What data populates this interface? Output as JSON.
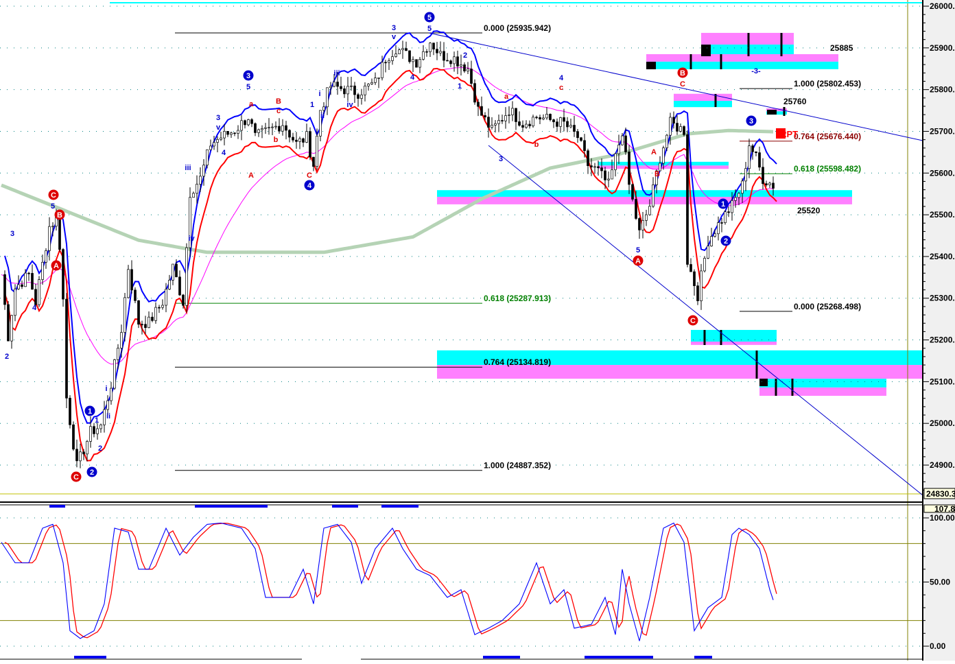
{
  "chart_data": {
    "type": "candlestick",
    "title": "",
    "colors": {
      "up": "#ffffff",
      "down": "#000000",
      "upper_band": "#0000ff",
      "lower_band": "#ff0000",
      "slow_ma": "#ff00ff",
      "long_ma": "#b5d3b5",
      "cyan": "#00ffff",
      "magenta": "#ff80ff",
      "stoch_k": "#0000ff",
      "stoch_d": "#ff0000",
      "trend": "#0000cc"
    },
    "price_axis": {
      "ylim": [
        24830,
        26000
      ],
      "ticks": [
        "26000.",
        "25900.",
        "25800.",
        "25700.",
        "25600.",
        "25500.",
        "25400.",
        "25300.",
        "25200.",
        "25100.",
        "25000.",
        "24900."
      ],
      "tick_values": [
        26000,
        25900,
        25800,
        25700,
        25600,
        25500,
        25400,
        25300,
        25200,
        25100,
        25000,
        24900
      ],
      "current_label": "24830.3"
    },
    "osc_axis": {
      "ylim": [
        0,
        100
      ],
      "ticks": [
        "100.00",
        "50.00",
        "0.00"
      ],
      "tick_values": [
        100,
        50,
        0
      ],
      "top_label": "107.8",
      "levels": [
        80,
        20
      ]
    },
    "price_path": [
      [
        0,
        25357
      ],
      [
        2,
        25209
      ],
      [
        4,
        25324
      ],
      [
        8,
        25357
      ],
      [
        10,
        25291
      ],
      [
        14,
        25472
      ],
      [
        16,
        25489
      ],
      [
        17.6,
        25390
      ],
      [
        19,
        25061
      ],
      [
        22,
        24897
      ],
      [
        26,
        24979
      ],
      [
        29,
        24995
      ],
      [
        32,
        25094
      ],
      [
        35,
        25226
      ],
      [
        37,
        25374
      ],
      [
        40,
        25242
      ],
      [
        43,
        25242
      ],
      [
        47,
        25291
      ],
      [
        50,
        25374
      ],
      [
        53,
        25291
      ],
      [
        55,
        25554
      ],
      [
        58,
        25587
      ],
      [
        61,
        25670
      ],
      [
        64,
        25686
      ],
      [
        68,
        25702
      ],
      [
        72,
        25735
      ],
      [
        74,
        25686
      ],
      [
        78,
        25702
      ],
      [
        82,
        25719
      ],
      [
        86,
        25670
      ],
      [
        89,
        25686
      ],
      [
        91,
        25620
      ],
      [
        93,
        25752
      ],
      [
        96,
        25809
      ],
      [
        100,
        25801
      ],
      [
        104,
        25793
      ],
      [
        109,
        25817
      ],
      [
        112,
        25875
      ],
      [
        115,
        25900
      ],
      [
        118,
        25883
      ],
      [
        121,
        25867
      ],
      [
        125,
        25916
      ],
      [
        128,
        25883
      ],
      [
        132,
        25875
      ],
      [
        136,
        25850
      ],
      [
        139,
        25752
      ],
      [
        143,
        25702
      ],
      [
        148,
        25752
      ],
      [
        152,
        25719
      ],
      [
        156,
        25735
      ],
      [
        160,
        25727
      ],
      [
        164,
        25719
      ],
      [
        168,
        25686
      ],
      [
        171,
        25620
      ],
      [
        174,
        25604
      ],
      [
        177,
        25571
      ],
      [
        181,
        25702
      ],
      [
        183,
        25571
      ],
      [
        186,
        25456
      ],
      [
        189,
        25522
      ],
      [
        192,
        25637
      ],
      [
        195,
        25719
      ],
      [
        199,
        25702
      ],
      [
        200,
        25390
      ],
      [
        203,
        25308
      ],
      [
        206,
        25439
      ],
      [
        210,
        25489
      ],
      [
        213,
        25522
      ],
      [
        216,
        25571
      ],
      [
        218,
        25670
      ],
      [
        220,
        25637
      ],
      [
        222,
        25587
      ],
      [
        225,
        25571
      ]
    ],
    "long_ma": [
      [
        0,
        25571
      ],
      [
        20,
        25505
      ],
      [
        40,
        25439
      ],
      [
        60,
        25410
      ],
      [
        94,
        25410
      ],
      [
        120,
        25447
      ],
      [
        140,
        25538
      ],
      [
        160,
        25612
      ],
      [
        180,
        25645
      ],
      [
        200,
        25694
      ],
      [
        212,
        25702
      ],
      [
        225,
        25699
      ]
    ],
    "stochastic": [
      [
        0,
        81
      ],
      [
        4,
        65
      ],
      [
        8,
        65
      ],
      [
        12,
        92
      ],
      [
        15,
        95
      ],
      [
        18,
        65
      ],
      [
        20,
        12
      ],
      [
        23,
        6
      ],
      [
        27,
        12
      ],
      [
        30,
        33
      ],
      [
        33,
        92
      ],
      [
        37,
        89
      ],
      [
        40,
        60
      ],
      [
        43,
        60
      ],
      [
        48,
        92
      ],
      [
        52,
        71
      ],
      [
        56,
        85
      ],
      [
        60,
        95
      ],
      [
        64,
        96
      ],
      [
        70,
        92
      ],
      [
        74,
        76
      ],
      [
        77,
        38
      ],
      [
        84,
        38
      ],
      [
        88,
        60
      ],
      [
        91,
        33
      ],
      [
        94,
        92
      ],
      [
        98,
        95
      ],
      [
        102,
        81
      ],
      [
        105,
        49
      ],
      [
        109,
        76
      ],
      [
        114,
        92
      ],
      [
        117,
        76
      ],
      [
        121,
        60
      ],
      [
        125,
        55
      ],
      [
        130,
        38
      ],
      [
        134,
        44
      ],
      [
        138,
        9
      ],
      [
        142,
        14
      ],
      [
        146,
        20
      ],
      [
        151,
        33
      ],
      [
        156,
        65
      ],
      [
        160,
        33
      ],
      [
        164,
        44
      ],
      [
        167,
        14
      ],
      [
        172,
        17
      ],
      [
        176,
        38
      ],
      [
        179,
        9
      ],
      [
        181,
        60
      ],
      [
        183,
        33
      ],
      [
        186,
        4
      ],
      [
        189,
        38
      ],
      [
        193,
        92
      ],
      [
        196,
        96
      ],
      [
        199,
        81
      ],
      [
        202,
        12
      ],
      [
        206,
        30
      ],
      [
        210,
        38
      ],
      [
        213,
        87
      ],
      [
        215,
        92
      ],
      [
        218,
        87
      ],
      [
        221,
        76
      ],
      [
        224,
        44
      ],
      [
        225,
        36
      ]
    ],
    "fib_levels_left": [
      {
        "label": "0.000 (25935.942)",
        "price": 25935.942,
        "color": "#000000"
      },
      {
        "label": "0.618 (25287.913)",
        "price": 25287.913,
        "color": "#008000"
      },
      {
        "label": "0.764 (25134.819)",
        "price": 25134.819,
        "color": "#000000"
      },
      {
        "label": "1.000 (24887.352)",
        "price": 24887.352,
        "color": "#000000"
      }
    ],
    "fib_levels_right": [
      {
        "label": "1.000 (25802.453)",
        "price": 25802.453,
        "color": "#000000"
      },
      {
        "label": "0.764 (25676.440)",
        "price": 25676.44,
        "color": "#8b0000"
      },
      {
        "label": "0.618 (25598.482)",
        "price": 25598.482,
        "color": "#008000"
      },
      {
        "label": "0.000 (25268.498)",
        "price": 25268.498,
        "color": "#000000"
      }
    ],
    "zones": [
      {
        "bars": [
          204,
          231
        ],
        "prices": [
          25936,
          25908,
          25880
        ],
        "order": "magenta-first"
      },
      {
        "bars": [
          188,
          244
        ],
        "prices": [
          25885,
          25867,
          25849
        ],
        "order": "magenta-first"
      },
      {
        "bars": [
          196,
          213
        ],
        "prices": [
          25790,
          25773,
          25758
        ],
        "order": "magenta-first"
      },
      {
        "bars": [
          223,
          229
        ],
        "prices": [
          25755,
          25748,
          25740
        ],
        "order": "magenta-first"
      },
      {
        "bars": [
          174,
          212
        ],
        "prices": [
          25627,
          25618,
          25610
        ],
        "order": "cyan-first"
      },
      {
        "bars": [
          127,
          248
        ],
        "prices": [
          25559,
          25543,
          25525
        ],
        "order": "cyan-first"
      },
      {
        "bars": [
          201,
          226
        ],
        "prices": [
          25224,
          25196,
          25188
        ],
        "order": "cyan-first"
      },
      {
        "bars": [
          127,
          269
        ],
        "prices": [
          25175,
          25140,
          25107
        ],
        "order": "cyan-first"
      },
      {
        "bars": [
          221,
          258
        ],
        "prices": [
          25107,
          25086,
          25066
        ],
        "order": "cyan-first"
      }
    ],
    "price_labels": [
      "25885",
      "25760",
      "25520"
    ],
    "badge": "22PT",
    "wave_labels": [
      "3",
      "5",
      "4",
      "2",
      "1",
      "i",
      "ii",
      "2",
      "iii",
      "iv",
      "3",
      "v",
      "4",
      "5",
      "i",
      "ii",
      "1",
      "iii",
      "iv",
      "3",
      "v",
      "5",
      "4",
      "2",
      "1",
      "3",
      "5",
      "-3-",
      "a",
      "B",
      "c",
      "b",
      "A",
      "C",
      "a",
      "4",
      "c",
      "b",
      "C",
      "A",
      "B"
    ],
    "wave_circles": [
      "3",
      "4",
      "5",
      "1",
      "2",
      "1",
      "2",
      "3",
      "C",
      "B",
      "A",
      "C",
      "B",
      "A",
      "C"
    ]
  }
}
